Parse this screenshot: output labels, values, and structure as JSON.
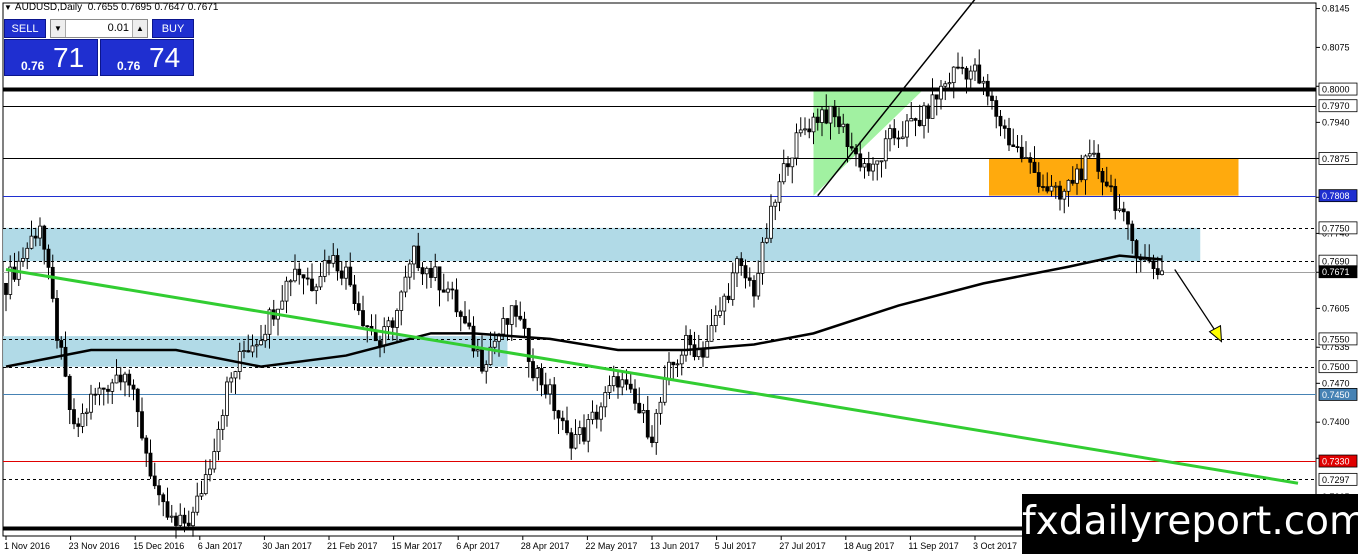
{
  "header": {
    "symbol": "AUDUSD,Daily",
    "ohlc": "0.7655 0.7695 0.7647 0.7671"
  },
  "trade_panel": {
    "sell_label": "SELL",
    "buy_label": "BUY",
    "lot_value": "0.01",
    "sell_price_small": "0.76",
    "sell_price_big": "71",
    "buy_price_small": "0.76",
    "buy_price_big": "74",
    "color": "#1f2fd0"
  },
  "watermark": "fxdailyreport.com",
  "colors": {
    "bull": "#ffffff",
    "bear": "#000000",
    "zone": "#add8e6",
    "orange_box": "#ffa500",
    "green_triangle": "#90ee90",
    "trendline": "#32cd32",
    "ma": "#000000",
    "support_red": "#e00000",
    "level_blue": "#1f2fd0"
  },
  "chart_data": {
    "type": "candlestick",
    "symbol": "AUDUSD",
    "timeframe": "Daily",
    "ylim": [
      0.7195,
      0.8155
    ],
    "y_ticks": [
      0.8145,
      0.8075,
      0.8005,
      0.794,
      0.7875,
      0.7805,
      0.774,
      0.767,
      0.7605,
      0.7535,
      0.747,
      0.74,
      0.7335,
      0.7265,
      0.72
    ],
    "x_tick_labels": [
      "1 Nov 2016",
      "23 Nov 2016",
      "15 Dec 2016",
      "6 Jan 2017",
      "30 Jan 2017",
      "21 Feb 2017",
      "15 Mar 2017",
      "6 Apr 2017",
      "28 Apr 2017",
      "22 May 2017",
      "13 Jun 2017",
      "5 Jul 2017",
      "27 Jul 2017",
      "18 Aug 2017",
      "11 Sep 2017",
      "3 Oct 2017"
    ],
    "close_path": [
      [
        0,
        0.765
      ],
      [
        4,
        0.77
      ],
      [
        8,
        0.776
      ],
      [
        12,
        0.756
      ],
      [
        16,
        0.738
      ],
      [
        20,
        0.744
      ],
      [
        24,
        0.747
      ],
      [
        28,
        0.75
      ],
      [
        32,
        0.738
      ],
      [
        36,
        0.725
      ],
      [
        40,
        0.721
      ],
      [
        44,
        0.723
      ],
      [
        48,
        0.733
      ],
      [
        52,
        0.746
      ],
      [
        56,
        0.753
      ],
      [
        60,
        0.756
      ],
      [
        64,
        0.762
      ],
      [
        68,
        0.768
      ],
      [
        72,
        0.765
      ],
      [
        76,
        0.77
      ],
      [
        80,
        0.767
      ],
      [
        84,
        0.759
      ],
      [
        88,
        0.754
      ],
      [
        92,
        0.76
      ],
      [
        96,
        0.77
      ],
      [
        100,
        0.767
      ],
      [
        104,
        0.764
      ],
      [
        108,
        0.757
      ],
      [
        112,
        0.751
      ],
      [
        116,
        0.756
      ],
      [
        120,
        0.76
      ],
      [
        124,
        0.75
      ],
      [
        128,
        0.745
      ],
      [
        132,
        0.737
      ],
      [
        136,
        0.738
      ],
      [
        140,
        0.743
      ],
      [
        144,
        0.748
      ],
      [
        148,
        0.743
      ],
      [
        152,
        0.738
      ],
      [
        156,
        0.749
      ],
      [
        160,
        0.754
      ],
      [
        164,
        0.753
      ],
      [
        168,
        0.76
      ],
      [
        172,
        0.768
      ],
      [
        176,
        0.764
      ],
      [
        180,
        0.777
      ],
      [
        184,
        0.788
      ],
      [
        188,
        0.793
      ],
      [
        192,
        0.796
      ],
      [
        196,
        0.794
      ],
      [
        200,
        0.788
      ],
      [
        204,
        0.785
      ],
      [
        208,
        0.791
      ],
      [
        212,
        0.793
      ],
      [
        216,
        0.795
      ],
      [
        220,
        0.8
      ],
      [
        224,
        0.804
      ],
      [
        228,
        0.803
      ],
      [
        232,
        0.797
      ],
      [
        236,
        0.791
      ],
      [
        240,
        0.787
      ],
      [
        244,
        0.783
      ],
      [
        248,
        0.78
      ],
      [
        252,
        0.785
      ],
      [
        256,
        0.787
      ],
      [
        260,
        0.782
      ],
      [
        264,
        0.774
      ],
      [
        268,
        0.769
      ],
      [
        272,
        0.7671
      ]
    ],
    "moving_average": [
      [
        0,
        0.75
      ],
      [
        20,
        0.753
      ],
      [
        40,
        0.753
      ],
      [
        60,
        0.75
      ],
      [
        80,
        0.752
      ],
      [
        100,
        0.756
      ],
      [
        110,
        0.756
      ],
      [
        128,
        0.755
      ],
      [
        144,
        0.753
      ],
      [
        160,
        0.753
      ],
      [
        176,
        0.754
      ],
      [
        190,
        0.756
      ],
      [
        210,
        0.761
      ],
      [
        230,
        0.765
      ],
      [
        250,
        0.768
      ],
      [
        262,
        0.77
      ],
      [
        272,
        0.7693
      ]
    ],
    "horizontal_levels": [
      {
        "price": 0.8,
        "label": "0.8000",
        "style": "thick"
      },
      {
        "price": 0.797,
        "label": "0.7970",
        "style": "solid"
      },
      {
        "price": 0.7875,
        "label": "0.7875",
        "style": "solid"
      },
      {
        "price": 0.7808,
        "label": "0.7808",
        "style": "solid-blue",
        "highlight": true
      },
      {
        "price": 0.775,
        "label": "0.7750",
        "style": "dashed"
      },
      {
        "price": 0.769,
        "label": "0.7690",
        "style": "dashed"
      },
      {
        "price": 0.7671,
        "label": "0.7671",
        "style": "current"
      },
      {
        "price": 0.755,
        "label": "0.7550",
        "style": "dashed"
      },
      {
        "price": 0.75,
        "label": "0.7500",
        "style": "dashed"
      },
      {
        "price": 0.745,
        "label": "0.7450",
        "style": "solid-steel",
        "highlight": true
      },
      {
        "price": 0.733,
        "label": "0.7330",
        "style": "solid-red",
        "highlight": true
      },
      {
        "price": 0.7297,
        "label": "0.7297",
        "style": "dashed"
      },
      {
        "price": 0.721,
        "style": "thick"
      }
    ],
    "zones": [
      {
        "from_bar": 0,
        "to_bar": 281,
        "low": 0.769,
        "high": 0.775,
        "color": "#add8e6"
      },
      {
        "from_bar": 0,
        "to_bar": 118,
        "low": 0.75,
        "high": 0.7555,
        "color": "#add8e6"
      },
      {
        "from_bar": 232,
        "to_bar": 290,
        "low": 0.7808,
        "high": 0.7875,
        "color": "#ffa500"
      }
    ],
    "green_triangle": [
      [
        190,
        0.8
      ],
      [
        216,
        0.8
      ],
      [
        190,
        0.7808
      ]
    ],
    "uptrend_line": [
      [
        191,
        0.7808
      ],
      [
        232,
        0.82
      ]
    ],
    "downtrend_line": [
      [
        0,
        0.7675
      ],
      [
        304,
        0.729
      ]
    ],
    "projection_arrow": {
      "from": [
        275,
        0.7675
      ],
      "to": [
        286,
        0.7545
      ]
    }
  }
}
